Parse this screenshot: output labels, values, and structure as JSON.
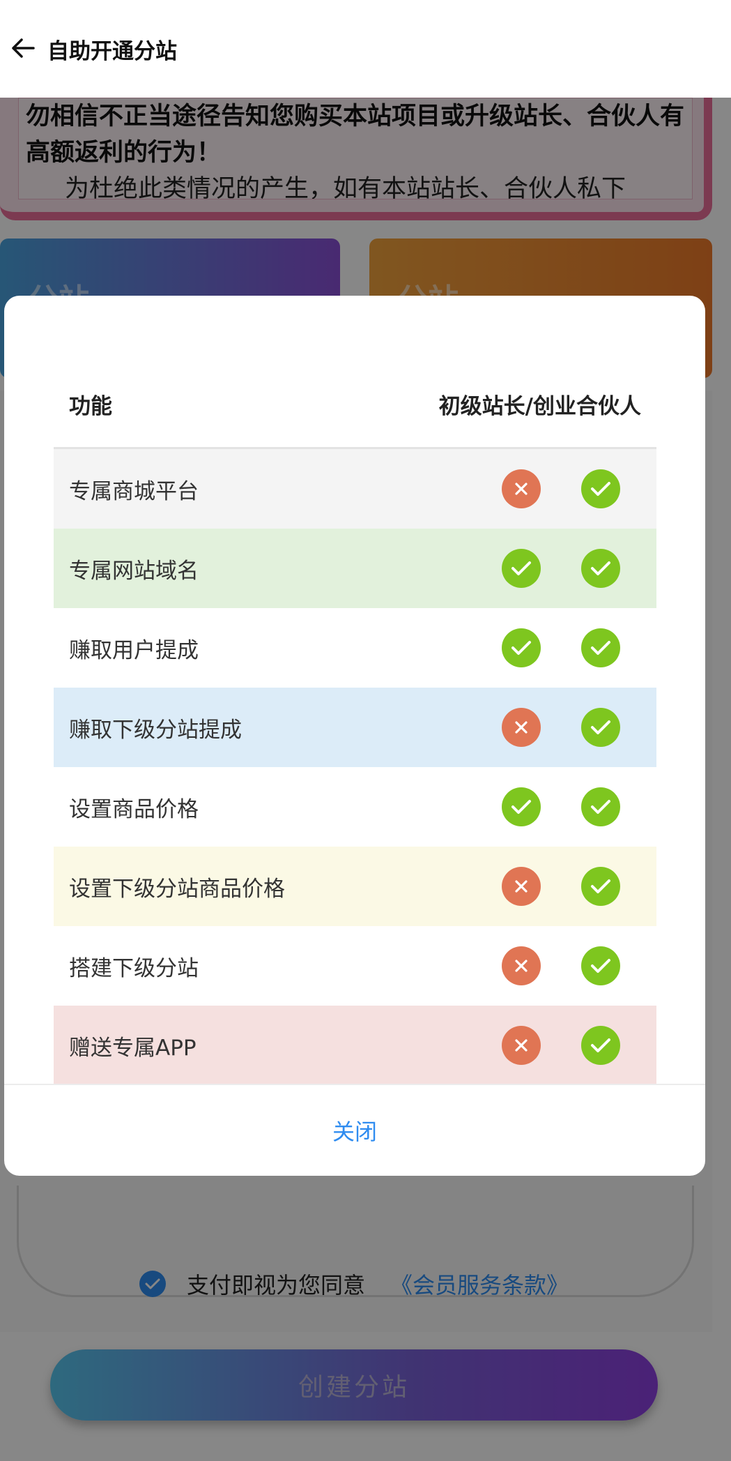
{
  "header": {
    "title": "自助开通分站"
  },
  "notice": {
    "line1": "勿相信不正当途径告知您购买本站项目或升级站长、合伙人有高额返利的行为！",
    "line2": "为杜绝此类情况的产生，如有本站站长、合伙人私下"
  },
  "cards": [
    {
      "label": "分站"
    },
    {
      "label": "分站"
    }
  ],
  "agreement": {
    "text": "支付即视为您同意",
    "link": "《会员服务条款》"
  },
  "create_button": {
    "label": "创建分站"
  },
  "modal": {
    "header_feature": "功能",
    "header_tiers": "初级站长/创业合伙人",
    "close_label": "关闭",
    "rows": [
      {
        "label": "专属商城平台",
        "bg": "#f4f4f4",
        "basic": false,
        "partner": true
      },
      {
        "label": "专属网站域名",
        "bg": "#e2f1dc",
        "basic": true,
        "partner": true
      },
      {
        "label": "赚取用户提成",
        "bg": "#ffffff",
        "basic": true,
        "partner": true
      },
      {
        "label": "赚取下级分站提成",
        "bg": "#dcecf8",
        "basic": false,
        "partner": true
      },
      {
        "label": "设置商品价格",
        "bg": "#ffffff",
        "basic": true,
        "partner": true
      },
      {
        "label": "设置下级分站商品价格",
        "bg": "#fbf9e5",
        "basic": false,
        "partner": true
      },
      {
        "label": "搭建下级分站",
        "bg": "#ffffff",
        "basic": false,
        "partner": true
      },
      {
        "label": "赠送专属APP",
        "bg": "#f5e0df",
        "basic": false,
        "partner": true
      }
    ]
  }
}
